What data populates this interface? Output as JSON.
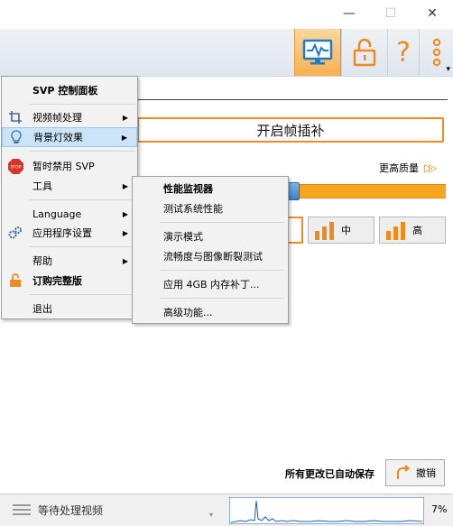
{
  "window": {
    "minimize": "—",
    "maximize": "☐",
    "close": "✕"
  },
  "toolbar": {
    "help_glyph": "?",
    "more_glyph": "⋮",
    "more_caret": "▾"
  },
  "main": {
    "smooth_button_label": "开启帧插补",
    "quality_label": "更高质量",
    "quality_arrow": "▷▷",
    "quality_buttons": [
      {
        "label": "中"
      },
      {
        "label": "高"
      }
    ],
    "autosave_text": "所有更改已自动保存",
    "undo_label": "撤销"
  },
  "status": {
    "waiting_text": "等待处理视频",
    "cpu_percent": "7%",
    "dropdown_caret": "▾"
  },
  "main_menu": {
    "title": "SVP 控制面板",
    "items": [
      {
        "label": "视频帧处理",
        "icon": "crop-icon",
        "has_submenu": true
      },
      {
        "label": "背景灯效果",
        "icon": "lightbulb-icon",
        "has_submenu": true,
        "highlighted": true
      },
      {
        "label": "暂时禁用 SVP",
        "icon": "stop-icon",
        "has_submenu": false
      },
      {
        "label": "工具",
        "icon": "",
        "has_submenu": true
      },
      {
        "label": "Language",
        "icon": "",
        "has_submenu": true
      },
      {
        "label": "应用程序设置",
        "icon": "gears-icon",
        "has_submenu": true
      },
      {
        "label": "帮助",
        "icon": "",
        "has_submenu": true
      },
      {
        "label": "订购完整版",
        "icon": "unlock-icon",
        "has_submenu": false
      },
      {
        "label": "退出",
        "icon": "",
        "has_submenu": false
      }
    ],
    "arrow_glyph": "▶",
    "stop_badge": "STOP"
  },
  "tools_submenu": {
    "items": [
      {
        "label": "性能监视器",
        "bold": true
      },
      {
        "label": "测试系统性能"
      },
      {
        "label": "演示模式"
      },
      {
        "label": "流畅度与图像断裂测试"
      },
      {
        "label": "应用 4GB 内存补丁..."
      },
      {
        "label": "高级功能..."
      }
    ]
  },
  "colors": {
    "accent_orange": "#F08A1E",
    "menu_highlight": "#CCE4F7",
    "toolbar_blue": "#1E7BC4",
    "graph_blue": "#1E5FA8"
  }
}
